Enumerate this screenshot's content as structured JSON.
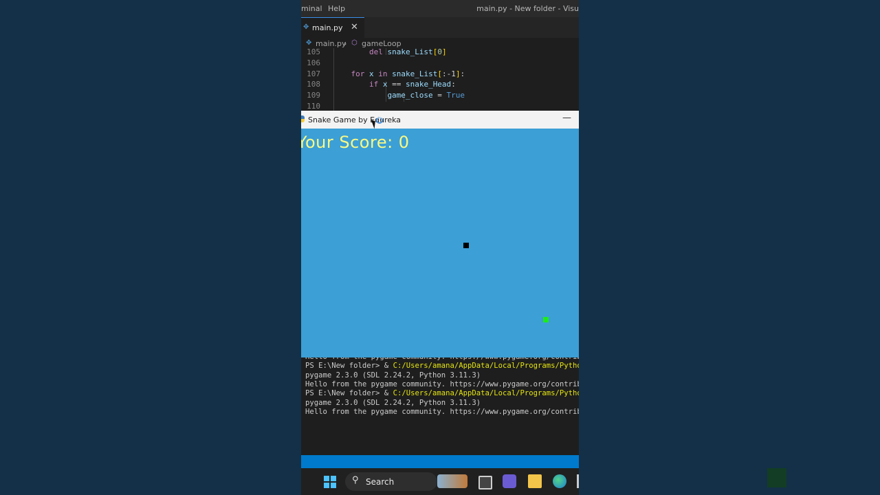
{
  "editor": {
    "menu": [
      "minal",
      "Help"
    ],
    "window_title": "main.py - New folder - Visu",
    "tab": {
      "label": "main.py",
      "close": "✕"
    },
    "breadcrumb": {
      "file": "main.py",
      "separator": "›",
      "symbol": "gameLoop"
    },
    "code_lines": [
      {
        "num": "105",
        "indent": 4,
        "tokens": [
          {
            "t": "del ",
            "c": "kw"
          },
          {
            "t": "snake_List",
            "c": "id"
          },
          {
            "t": "[",
            "c": "br"
          },
          {
            "t": "0",
            "c": "num"
          },
          {
            "t": "]",
            "c": "br"
          }
        ]
      },
      {
        "num": "106",
        "indent": 0,
        "tokens": []
      },
      {
        "num": "107",
        "indent": 2,
        "tokens": [
          {
            "t": "for ",
            "c": "kw"
          },
          {
            "t": "x",
            "c": "id"
          },
          {
            "t": " in ",
            "c": "kw"
          },
          {
            "t": "snake_List",
            "c": "id"
          },
          {
            "t": "[",
            "c": "br"
          },
          {
            "t": ":-1",
            "c": "tx"
          },
          {
            "t": "]",
            "c": "br"
          },
          {
            "t": ":",
            "c": "tx"
          }
        ]
      },
      {
        "num": "108",
        "indent": 4,
        "tokens": [
          {
            "t": "if ",
            "c": "kw"
          },
          {
            "t": "x",
            "c": "id"
          },
          {
            "t": " == ",
            "c": "tx"
          },
          {
            "t": "snake_Head",
            "c": "id"
          },
          {
            "t": ":",
            "c": "tx"
          }
        ]
      },
      {
        "num": "109",
        "indent": 6,
        "tokens": [
          {
            "t": "game_close",
            "c": "id"
          },
          {
            "t": " = ",
            "c": "tx"
          },
          {
            "t": "True",
            "c": "bool"
          }
        ]
      },
      {
        "num": "110",
        "indent": 0,
        "tokens": []
      }
    ]
  },
  "game_window": {
    "title": "Snake Game by Edureka",
    "minimize": "—",
    "score_text": "Your Score: 0",
    "colors": {
      "background": "#3c9fd5",
      "score": "#f9f983",
      "snake": "#000000",
      "food": "#1eea1e"
    }
  },
  "terminal": {
    "lines": [
      {
        "text": "Hello from the pygame community. https://www.pygame.org/contribute"
      },
      {
        "prompt": "PS E:\\New folder> & ",
        "path": "C:/Users/amana/AppData/Local/Programs/Python/Py"
      },
      {
        "text": "pygame 2.3.0 (SDL 2.24.2, Python 3.11.3)"
      },
      {
        "text": "Hello from the pygame community. https://www.pygame.org/contribute"
      },
      {
        "prompt": "PS E:\\New folder> & ",
        "path": "C:/Users/amana/AppData/Local/Programs/Python/Py"
      },
      {
        "text": "pygame 2.3.0 (SDL 2.24.2, Python 3.11.3)"
      },
      {
        "text": "Hello from the pygame community. https://www.pygame.org/contribute"
      }
    ]
  },
  "taskbar": {
    "search_label": "Search",
    "icons": [
      "windows-start-icon",
      "search-icon",
      "widgets-icon",
      "task-view-icon",
      "teams-icon",
      "file-explorer-icon",
      "edge-icon"
    ]
  }
}
